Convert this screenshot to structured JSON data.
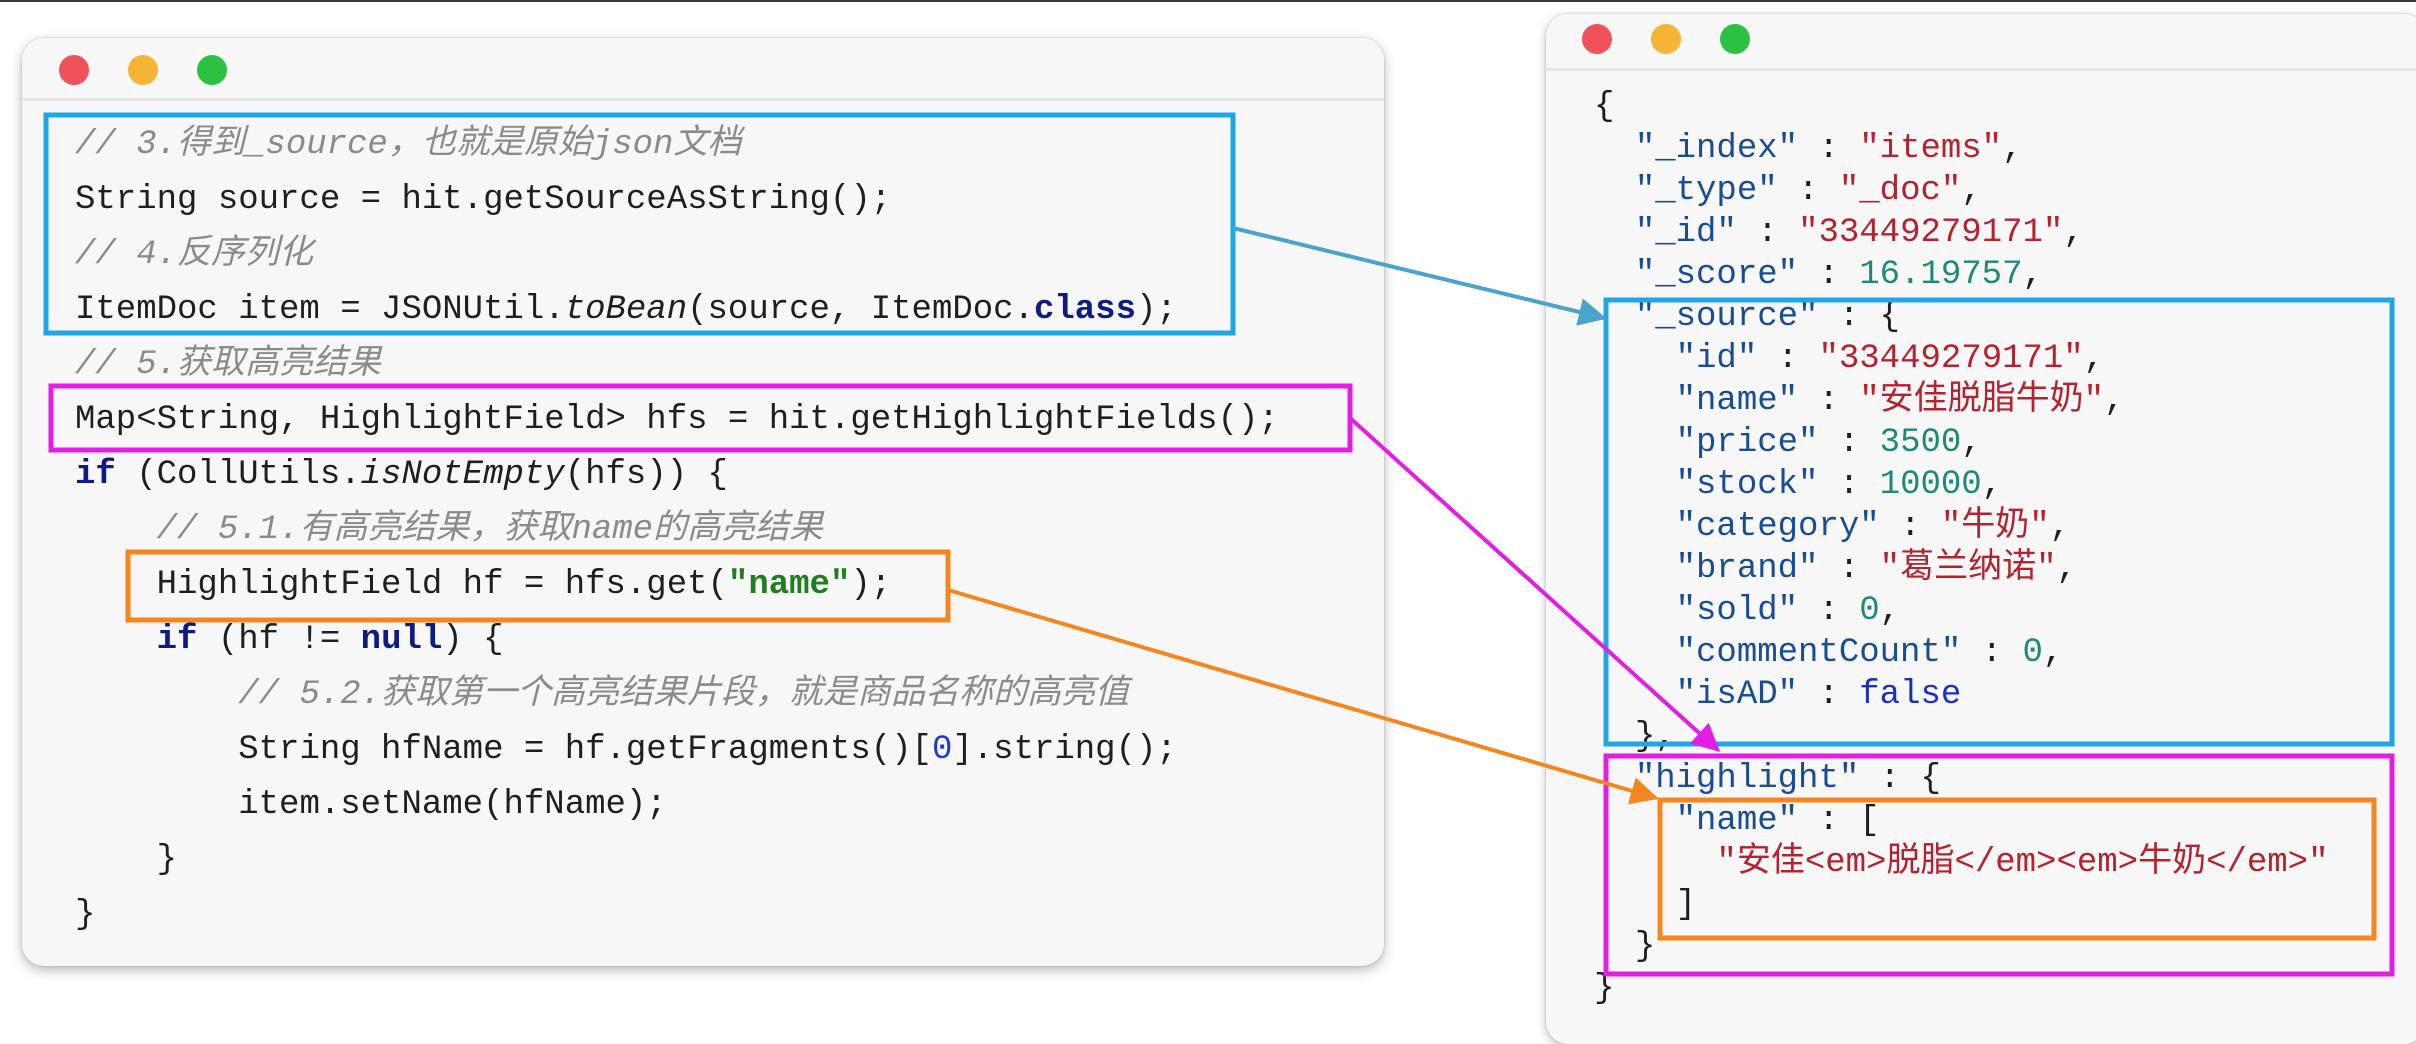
{
  "code_window": {
    "comment_3": "// 3.得到_source，也就是原始json文档",
    "line_source_a": "String source = hit.getSourceAsString();",
    "comment_4": "// 4.反序列化",
    "line_item_a": "ItemDoc item = JSONUtil.",
    "line_item_b": "toBean",
    "line_item_c": "(source, ItemDoc.",
    "line_item_d": "class",
    "line_item_e": ");",
    "comment_5": "// 5.获取高亮结果",
    "line_map": "Map<String, HighlightField> hfs = hit.getHighlightFields();",
    "line_if1_a": "if",
    "line_if1_b": " (CollUtils.",
    "line_if1_c": "isNotEmpty",
    "line_if1_d": "(hfs)) {",
    "comment_51": "// 5.1.有高亮结果，获取name的高亮结果",
    "line_hf_a": "HighlightField hf = hfs.get(",
    "line_hf_b": "\"name\"",
    "line_hf_c": ");",
    "line_if2_a": "if",
    "line_if2_b": " (hf != ",
    "line_if2_c": "null",
    "line_if2_d": ") {",
    "comment_52": "// 5.2.获取第一个高亮结果片段，就是商品名称的高亮值",
    "line_hfname_a": "String hfName = hf.getFragments()[",
    "line_hfname_b": "0",
    "line_hfname_c": "].string();",
    "line_setname": "item.setName(hfName);",
    "brace_inner": "}",
    "brace_outer": "}"
  },
  "json_window": {
    "open_brace": "{",
    "index_key": "\"_index\"",
    "index_val": "\"items\"",
    "type_key": "\"_type\"",
    "type_val": "\"_doc\"",
    "id_key": "\"_id\"",
    "id_val": "\"33449279171\"",
    "score_key": "\"_score\"",
    "score_val": "16.19757",
    "source_key": "\"_source\"",
    "src_id_key": "\"id\"",
    "src_id_val": "\"33449279171\"",
    "src_name_key": "\"name\"",
    "src_name_val": "\"安佳脱脂牛奶\"",
    "src_price_key": "\"price\"",
    "src_price_val": "3500",
    "src_stock_key": "\"stock\"",
    "src_stock_val": "10000",
    "src_category_key": "\"category\"",
    "src_category_val": "\"牛奶\"",
    "src_brand_key": "\"brand\"",
    "src_brand_val": "\"葛兰纳诺\"",
    "src_sold_key": "\"sold\"",
    "src_sold_val": "0",
    "src_comment_key": "\"commentCount\"",
    "src_comment_val": "0",
    "src_isad_key": "\"isAD\"",
    "src_isad_val": "false",
    "source_close": "},",
    "highlight_key": "\"highlight\"",
    "hl_name_key": "\"name\"",
    "hl_value": "\"安佳<em>脱脂</em><em>牛奶</em>\"",
    "hl_array_close": "]",
    "highlight_close": "}",
    "close_brace": "}"
  },
  "colors": {
    "blue_box": "#1ea7e4",
    "magenta_box": "#e11ee1",
    "orange_box": "#f4861f",
    "arrow_blue": "#4aa3cb",
    "arrow_magenta": "#e11ee1",
    "arrow_orange": "#f4861f"
  }
}
